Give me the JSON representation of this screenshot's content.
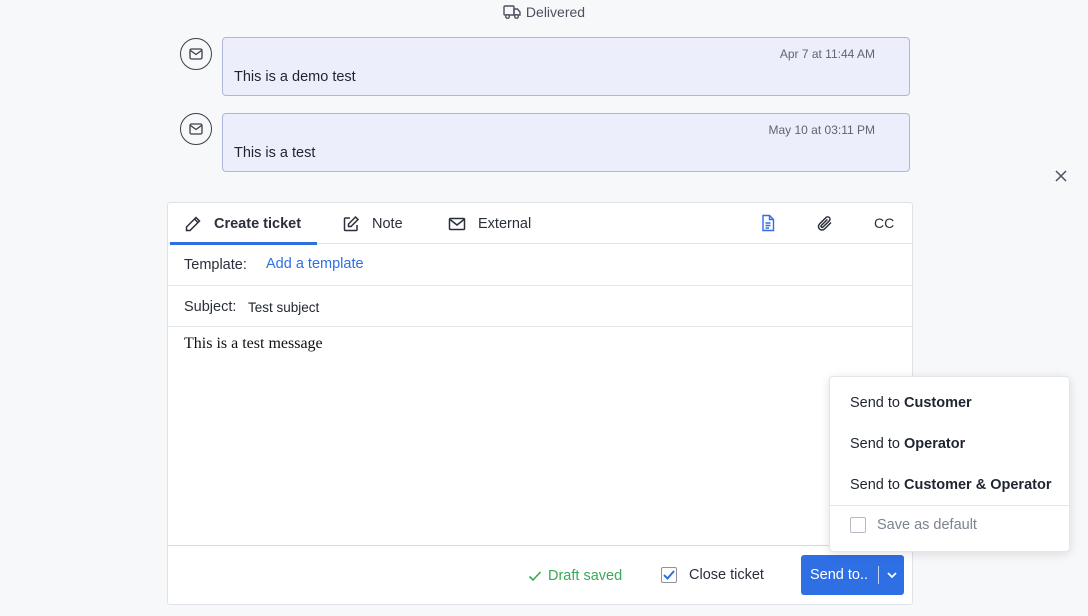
{
  "status": {
    "label": "Delivered",
    "icon": "truck-icon"
  },
  "messages": [
    {
      "time": "Apr 7 at 11:44 AM",
      "text": "This is a demo test",
      "icon": "mail-icon"
    },
    {
      "time": "May 10 at 03:11 PM",
      "text": "This is a test",
      "icon": "mail-icon"
    }
  ],
  "composer": {
    "tabs": [
      {
        "label": "Create ticket",
        "icon": "pencil-icon",
        "active": true
      },
      {
        "label": "Note",
        "icon": "edit-note-icon",
        "active": false
      },
      {
        "label": "External",
        "icon": "envelope-icon",
        "active": false
      }
    ],
    "tools": {
      "cc_label": "CC"
    },
    "template": {
      "label": "Template:",
      "link": "Add a template"
    },
    "subject": {
      "label": "Subject:",
      "value": "Test subject"
    },
    "body": "This is a test message",
    "footer": {
      "draft_status": "Draft saved",
      "close_ticket_label": "Close ticket",
      "close_ticket_checked": true,
      "send_label": "Send to.."
    }
  },
  "send_menu": {
    "prefix": "Send to",
    "items": [
      {
        "target": "Customer"
      },
      {
        "target": "Operator"
      },
      {
        "target": "Customer & Operator"
      }
    ],
    "save_default_label": "Save as default",
    "save_default_checked": false
  },
  "colors": {
    "accent": "#2f6fe4",
    "success": "#38a85a",
    "bubble_bg": "#eceffb",
    "bubble_border": "#aeb7d9"
  }
}
